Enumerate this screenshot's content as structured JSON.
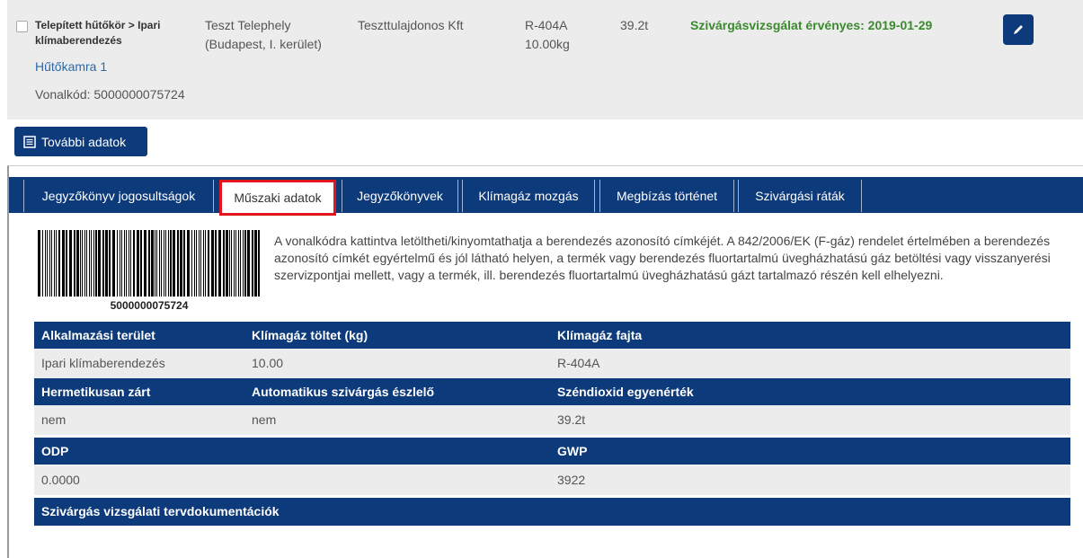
{
  "equipment": {
    "category": "Telepített hűtőkör > Ipari klímaberendezés",
    "category_line1": "Telepített hűtőkör > Ipari",
    "category_line2": "klímaberendezés",
    "room": "Hűtőkamra 1",
    "barcode_label": "Vonalkód: 5000000075724",
    "site_line1": "Teszt Telephely",
    "site_line2": "(Budapest, I. kerület)",
    "owner": "Teszttulajdonos Kft",
    "gas_type": "R-404A",
    "gas_amount": "10.00kg",
    "co2": "39.2t",
    "status": "Szivárgásvizsgálat érvényes: 2019-01-29",
    "status_color": "#3b8a2e"
  },
  "more_button": {
    "label": "További adatok",
    "icon": "list-icon"
  },
  "tabs": [
    {
      "label": "Jegyzőkönyv jogosultságok",
      "active": false
    },
    {
      "label": "Műszaki adatok",
      "active": true
    },
    {
      "label": "Jegyzőkönyvek",
      "active": false
    },
    {
      "label": "Klímagáz mozgás",
      "active": false
    },
    {
      "label": "Megbízás történet",
      "active": false
    },
    {
      "label": "Szivárgási ráták",
      "active": false
    }
  ],
  "barcode": {
    "number": "5000000075724"
  },
  "description": "A vonalkódra kattintva letöltheti/kinyomtathatja a berendezés azonosító címkéjét. A 842/2006/EK (F-gáz) rendelet értelmében a berendezés azonosító címkét egyértelmű és jól látható helyen, a termék vagy berendezés fluortartalmú üvegházhatású gáz betöltési vagy visszanyerési szervizpontjai mellett, vagy a termék, ill. berendezés fluortartalmú üvegházhatású gázt tartalmazó részén kell elhelyezni.",
  "table": {
    "h1": [
      "Alkalmazási terület",
      "Klímagáz töltet (kg)",
      "Klímagáz fajta"
    ],
    "r1": [
      "Ipari klímaberendezés",
      "10.00",
      "R-404A"
    ],
    "h2": [
      "Hermetikusan zárt",
      "Automatikus szivárgás észlelő",
      "Széndioxid egyenérték"
    ],
    "r2": [
      "nem",
      "nem",
      "39.2t"
    ],
    "h3": [
      "ODP",
      "",
      "GWP"
    ],
    "r3": [
      "0.0000",
      "",
      "3922"
    ],
    "h4": [
      "Szivárgás vizsgálati tervdokumentációk"
    ]
  },
  "colors": {
    "primary": "#0d3a7a",
    "tab_highlight": "#e0161c",
    "row_bg": "#ececec",
    "link": "#2a6aa8"
  }
}
